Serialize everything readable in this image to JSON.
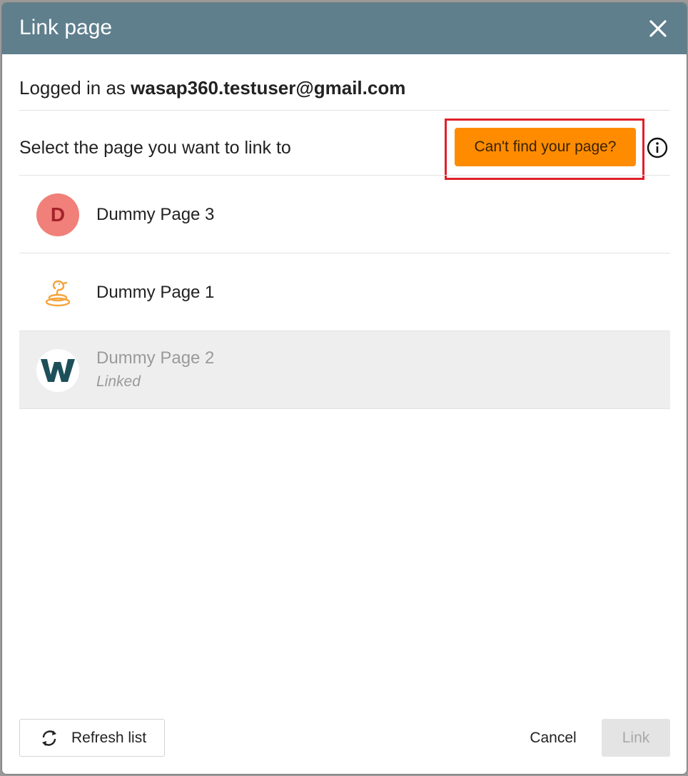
{
  "dialog": {
    "title": "Link page",
    "login_prefix": "Logged in as",
    "login_email": "wasap360.testuser@gmail.com",
    "select_label": "Select the page you want to link to",
    "cant_find_label": "Can't find your page?"
  },
  "pages": [
    {
      "name": "Dummy Page 3",
      "avatar_letter": "D",
      "avatar_color": "#f08079",
      "linked": false
    },
    {
      "name": "Dummy Page 1",
      "avatar_icon": "snake-icon",
      "avatar_color": "#f5a33a",
      "linked": false
    },
    {
      "name": "Dummy Page 2",
      "avatar_icon": "w-logo-icon",
      "avatar_color": "#1c4f5a",
      "linked": true,
      "status": "Linked"
    }
  ],
  "footer": {
    "refresh_label": "Refresh list",
    "cancel_label": "Cancel",
    "link_label": "Link"
  },
  "colors": {
    "header": "#5f7f8d",
    "accent": "#ff8c00",
    "highlight": "#e0202a"
  }
}
